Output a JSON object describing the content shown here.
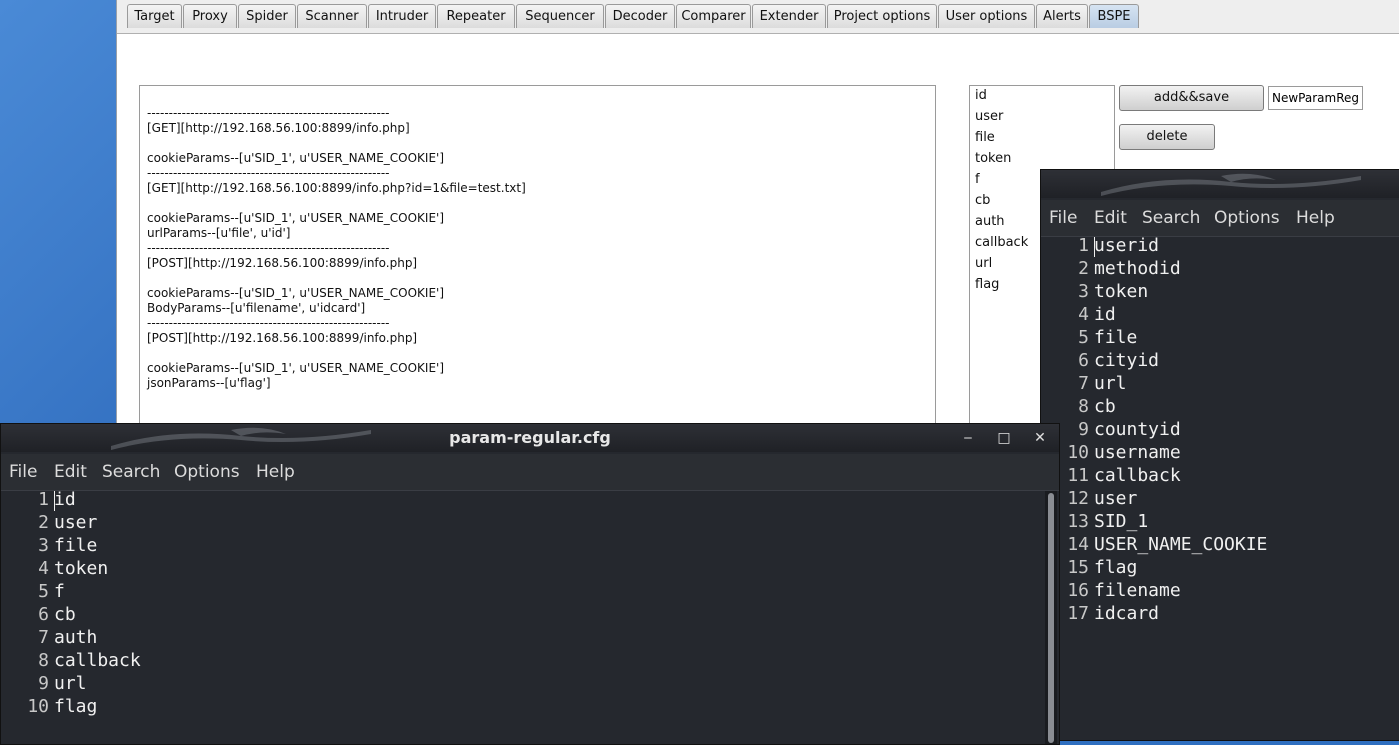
{
  "burp": {
    "tabs": [
      "Target",
      "Proxy",
      "Spider",
      "Scanner",
      "Intruder",
      "Repeater",
      "Sequencer",
      "Decoder",
      "Comparer",
      "Extender",
      "Project options",
      "User options",
      "Alerts",
      "BSPE"
    ],
    "active_tab": "BSPE",
    "log_lines": [
      "--------------------------------------------------------",
      "[GET][http://192.168.56.100:8899/info.php]",
      "",
      "cookieParams--[u'SID_1', u'USER_NAME_COOKIE']",
      "--------------------------------------------------------",
      "[GET][http://192.168.56.100:8899/info.php?id=1&file=test.txt]",
      "",
      "cookieParams--[u'SID_1', u'USER_NAME_COOKIE']",
      "urlParams--[u'file', u'id']",
      "--------------------------------------------------------",
      "[POST][http://192.168.56.100:8899/info.php]",
      "",
      "cookieParams--[u'SID_1', u'USER_NAME_COOKIE']",
      "BodyParams--[u'filename', u'idcard']",
      "--------------------------------------------------------",
      "[POST][http://192.168.56.100:8899/info.php]",
      "",
      "cookieParams--[u'SID_1', u'USER_NAME_COOKIE']",
      "jsonParams--[u'flag']"
    ],
    "param_list": [
      "id",
      "user",
      "file",
      "token",
      "f",
      "cb",
      "auth",
      "callback",
      "url",
      "flag"
    ],
    "add_save_label": "add&&save",
    "delete_label": "delete",
    "name_field_value": "NewParamReg"
  },
  "editor_left": {
    "title": "param-regular.cfg",
    "menu": [
      "File",
      "Edit",
      "Search",
      "Options",
      "Help"
    ],
    "lines": [
      "id",
      "user",
      "file",
      "token",
      "f",
      "cb",
      "auth",
      "callback",
      "url",
      "flag"
    ],
    "controls": {
      "minimize": "‒",
      "maximize": "□",
      "close": "✕"
    }
  },
  "editor_right": {
    "menu": [
      "File",
      "Edit",
      "Search",
      "Options",
      "Help"
    ],
    "lines": [
      "userid",
      "methodid",
      "token",
      "id",
      "file",
      "cityid",
      "url",
      "cb",
      "countyid",
      "username",
      "callback",
      "user",
      "SID_1",
      "USER_NAME_COOKIE",
      "flag",
      "filename",
      "idcard"
    ]
  },
  "icons": [
    "kali-dragon-icon",
    "minimize-icon",
    "maximize-icon",
    "close-icon"
  ]
}
